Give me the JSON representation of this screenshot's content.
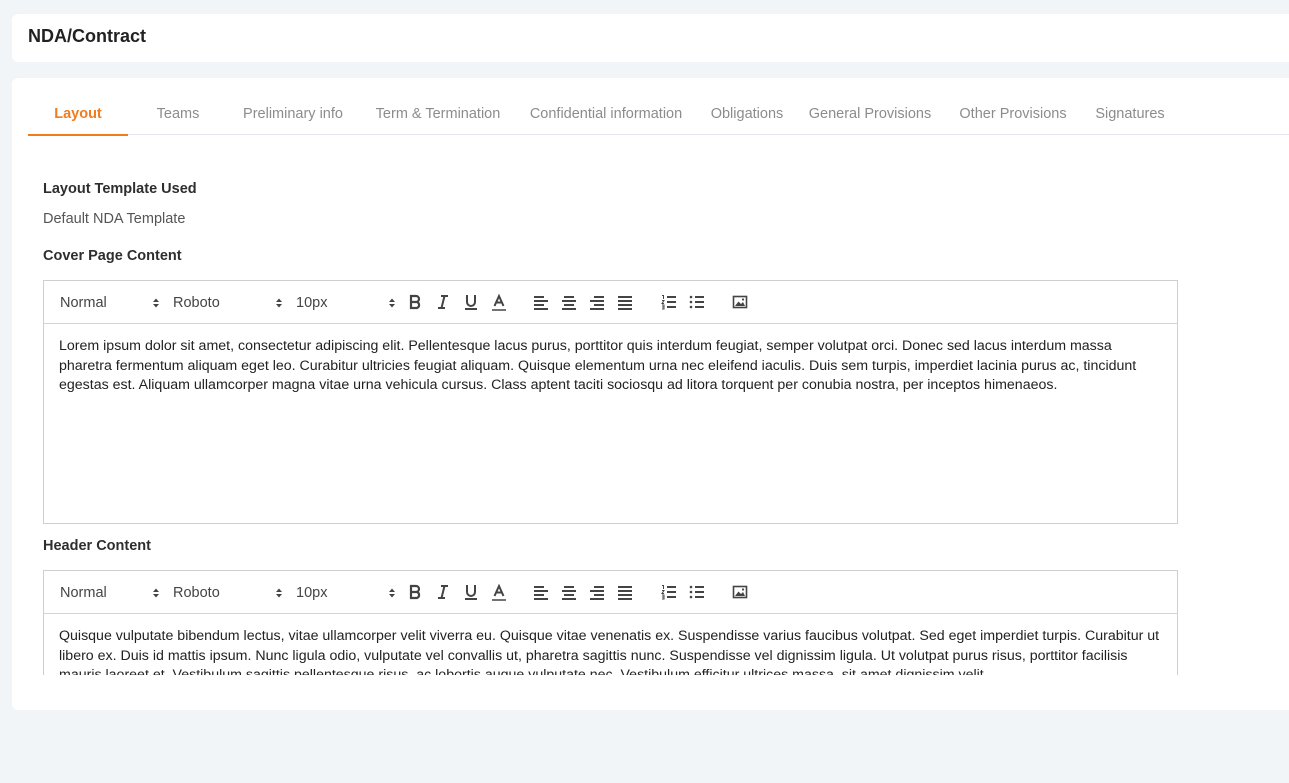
{
  "page": {
    "title": "NDA/Contract"
  },
  "tabs": [
    {
      "label": "Layout",
      "active": true
    },
    {
      "label": "Teams"
    },
    {
      "label": "Preliminary info"
    },
    {
      "label": "Term & Termination"
    },
    {
      "label": "Confidential information"
    },
    {
      "label": "Obligations"
    },
    {
      "label": "General Provisions"
    },
    {
      "label": "Other Provisions"
    },
    {
      "label": "Signatures"
    }
  ],
  "layout": {
    "template_label": "Layout Template Used",
    "template_value": "Default NDA Template",
    "cover_label": "Cover Page Content",
    "header_label": "Header Content"
  },
  "toolbar": {
    "format": "Normal",
    "font": "Roboto",
    "size": "10px"
  },
  "editors": {
    "cover_text": "Lorem ipsum dolor sit amet, consectetur adipiscing elit. Pellentesque lacus purus, porttitor quis interdum feugiat, semper volutpat orci. Donec sed lacus interdum massa pharetra fermentum aliquam eget leo. Curabitur ultricies feugiat aliquam. Quisque elementum urna nec eleifend iaculis. Duis sem turpis, imperdiet lacinia purus ac, tincidunt egestas est. Aliquam ullamcorper magna vitae urna vehicula cursus. Class aptent taciti sociosqu ad litora torquent per conubia nostra, per inceptos himenaeos.",
    "header_text": "Quisque vulputate bibendum lectus, vitae ullamcorper velit viverra eu. Quisque vitae venenatis ex. Suspendisse varius faucibus volutpat. Sed eget imperdiet turpis. Curabitur ut libero ex. Duis id mattis ipsum. Nunc ligula odio, vulputate vel convallis ut, pharetra sagittis nunc. Suspendisse vel dignissim ligula. Ut volutpat purus risus, porttitor facilisis mauris laoreet et. Vestibulum sagittis pellentesque risus, ac lobortis augue vulputate nec. Vestibulum efficitur ultrices massa, sit amet dignissim velit."
  },
  "colors": {
    "accent": "#f07c1d",
    "background": "#f2f5f8"
  }
}
